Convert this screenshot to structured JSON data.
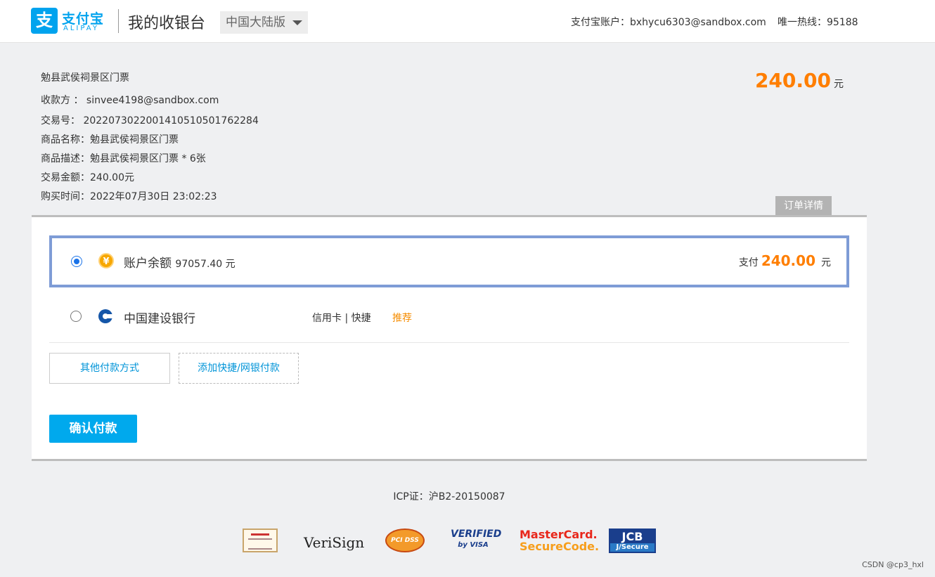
{
  "header": {
    "logo_cn": "支付宝",
    "logo_en": "ALIPAY",
    "logo_mark": "支",
    "title": "我的收银台",
    "region": "中国大陆版",
    "account": "支付宝账户：bxhycu6303@sandbox.com",
    "hotline": "唯一热线：95188"
  },
  "order": {
    "subject": "勉县武侯祠景区门票",
    "payee": "收款方 ： sinvee4198@sandbox.com",
    "trade_no": "交易号：    20220730220014105105017622​84",
    "product_name": "商品名称：勉县武侯祠景区门票",
    "description": "商品描述：勉县武侯祠景区门票 * 6张",
    "trade_amount": "交易金额：240.00元",
    "purchase_time": "购买时间：2022年07月30日 23:02:23",
    "amount": "240.00",
    "amount_unit": "元",
    "detail_tab": "订单详情"
  },
  "payment": {
    "balance_icon_glyph": "¥",
    "balance_label": "账户余额",
    "balance_value": "97057.40 元",
    "pay_label": "支付",
    "pay_amount": "240.00",
    "pay_unit": "元",
    "bank_name": "中国建设银行",
    "bank_tags": "信用卡 | 快捷",
    "recommend": "推荐",
    "other_methods": "其他付款方式",
    "add_method": "添加快捷/网银付款",
    "confirm": "确认付款"
  },
  "footer": {
    "icp": "ICP证：沪B2-20150087",
    "badges": {
      "verisign": "VeriSign",
      "pcidss": "PCI DSS",
      "visa_1": "VERIFIED",
      "visa_2": "by VISA",
      "mc_1": "MasterCard.",
      "mc_2": "SecureCode.",
      "jcb_1": "JCB",
      "jcb_2": "J/Secure"
    },
    "watermark": "CSDN @cp3_hxl"
  },
  "colors": {
    "brand": "#00a3ee",
    "amount": "#ff7e00",
    "selected_border": "#7e9cd6",
    "confirm_button": "#00a9ed"
  }
}
